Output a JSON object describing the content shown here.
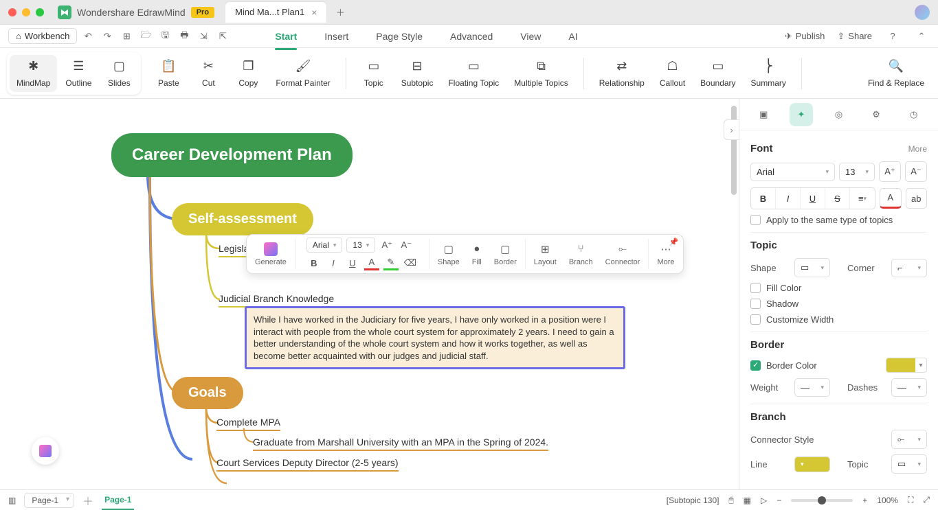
{
  "app": {
    "name": "Wondershare EdrawMind",
    "badge": "Pro"
  },
  "tabs": {
    "doc": "Mind Ma...t Plan1"
  },
  "menu": {
    "workbench": "Workbench",
    "items": [
      "Start",
      "Insert",
      "Page Style",
      "Advanced",
      "View",
      "AI"
    ],
    "publish": "Publish",
    "share": "Share"
  },
  "ribbon": {
    "views": [
      "MindMap",
      "Outline",
      "Slides"
    ],
    "edit": [
      "Paste",
      "Cut",
      "Copy",
      "Format Painter"
    ],
    "topic": [
      "Topic",
      "Subtopic",
      "Floating Topic",
      "Multiple Topics"
    ],
    "rel": [
      "Relationship",
      "Callout",
      "Boundary",
      "Summary"
    ],
    "find": "Find & Replace"
  },
  "mindmap": {
    "root": "Career Development Plan",
    "n1": "Self-assessment",
    "n1a": "Legislat",
    "n1b": "Judicial Branch Knowledge",
    "n1b_text": "While I have worked in the Judiciary for five years, I have only worked in a position were I interact with people from the whole court system for approximately 2 years.  I need to gain a better understanding of the whole court system and how it works together, as well as become better acquainted with our judges and judicial staff.",
    "n2": "Goals",
    "n2a": "Complete MPA",
    "n2a1": "Graduate from Marshall University with an MPA in the Spring of 2024.",
    "n2b": "Court Services Deputy Director (2-5 years)"
  },
  "float_tb": {
    "gen": "Generate",
    "font": "Arial",
    "size": "13",
    "shape": "Shape",
    "fill": "Fill",
    "border": "Border",
    "layout": "Layout",
    "branch": "Branch",
    "connector": "Connector",
    "more": "More"
  },
  "panel": {
    "font": {
      "title": "Font",
      "more": "More",
      "family": "Arial",
      "size": "13",
      "apply": "Apply to the same type of topics"
    },
    "topic": {
      "title": "Topic",
      "shape": "Shape",
      "corner": "Corner",
      "fill": "Fill Color",
      "shadow": "Shadow",
      "custw": "Customize Width"
    },
    "border": {
      "title": "Border",
      "bc": "Border Color",
      "weight": "Weight",
      "dashes": "Dashes"
    },
    "branch": {
      "title": "Branch",
      "cs": "Connector Style",
      "line": "Line",
      "tp": "Topic"
    }
  },
  "status": {
    "page_sel": "Page-1",
    "page_tab": "Page-1",
    "sel": "[Subtopic 130]",
    "zoom": "100%"
  }
}
